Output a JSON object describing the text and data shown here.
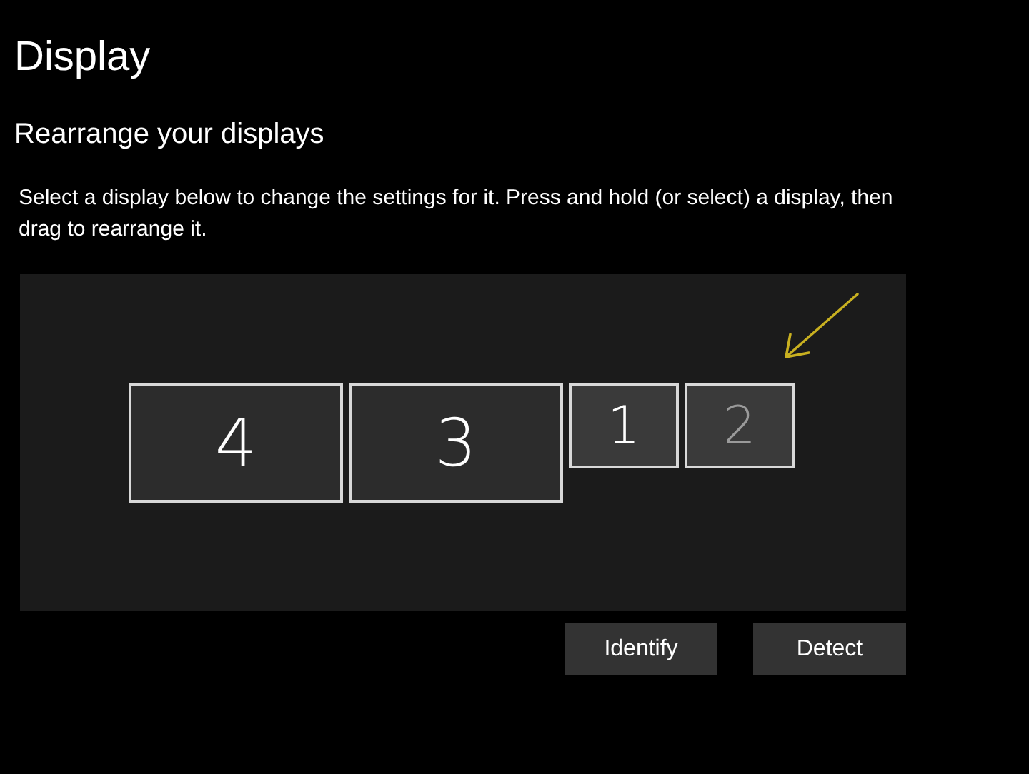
{
  "title": "Display",
  "section": {
    "heading": "Rearrange your displays",
    "description": "Select a display below to change the settings for it. Press and hold (or select) a display, then drag to rearrange it."
  },
  "displays": [
    {
      "label": "4",
      "kind": "large",
      "dimmed": false
    },
    {
      "label": "3",
      "kind": "large",
      "dimmed": false
    },
    {
      "label": "1",
      "kind": "small",
      "dimmed": false
    },
    {
      "label": "2",
      "kind": "small",
      "dimmed": true
    }
  ],
  "buttons": [
    "Identify",
    "Detect"
  ]
}
